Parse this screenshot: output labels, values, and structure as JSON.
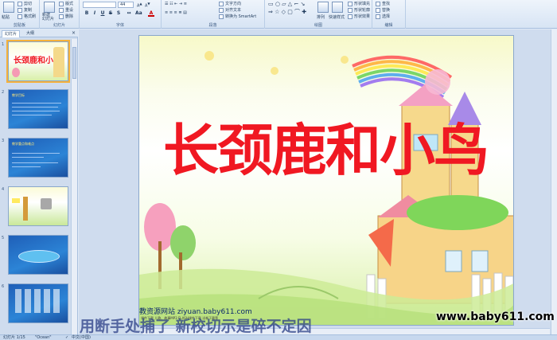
{
  "ribbon": {
    "clipboard": {
      "paste": "粘贴",
      "cut": "剪切",
      "copy": "复制",
      "painter": "格式刷",
      "label": "剪贴板"
    },
    "slides": {
      "new_slide": "新建\n幻灯片",
      "layout": "版式",
      "reset": "重设",
      "delete": "删除",
      "label": "幻灯片"
    },
    "font": {
      "font_name": "",
      "font_size": "44",
      "bold": "B",
      "italic": "I",
      "underline": "U",
      "strike": "S",
      "shadow": "S",
      "label": "字体"
    },
    "paragraph": {
      "text_direction": "文字方向",
      "align_text": "对齐文本",
      "smartart": "转换为 SmartArt",
      "label": "段落"
    },
    "drawing": {
      "arrange": "排列",
      "quick_styles": "快速样式",
      "shape_fill": "形状填充",
      "shape_outline": "形状轮廓",
      "shape_effects": "形状效果",
      "label": "绘图"
    },
    "editing": {
      "find": "查找",
      "replace": "替换",
      "select": "选择",
      "label": "编辑"
    }
  },
  "panel": {
    "tabs": [
      "幻灯片",
      "大纲"
    ],
    "close": "×",
    "thumbnails": [
      {
        "num": "1",
        "title": "长颈鹿和小鸟"
      },
      {
        "num": "2",
        "title": "教学目标"
      },
      {
        "num": "3",
        "title": "教学重点和难点"
      },
      {
        "num": "4",
        "title": ""
      },
      {
        "num": "5",
        "title": ""
      },
      {
        "num": "6",
        "title": ""
      }
    ]
  },
  "slide": {
    "title": "长颈鹿和小鸟",
    "site_logo": "教资源网站  ziyuan.baby611.com",
    "site_sub": "课件下载  儿歌、故事MP3  FLASH课件下载  试卷下载等"
  },
  "notes_text": "用断手处捕了  新校切示是碎不定因",
  "watermark": "www.baby611.com",
  "status": {
    "slide_count": "幻灯片 1/15",
    "theme": "\"Ocean\"",
    "language": "中文(中国)"
  },
  "colors": {
    "title": "#f01822",
    "ribbon_bg": "#dfe9f6",
    "accent": "#f5b13a"
  }
}
